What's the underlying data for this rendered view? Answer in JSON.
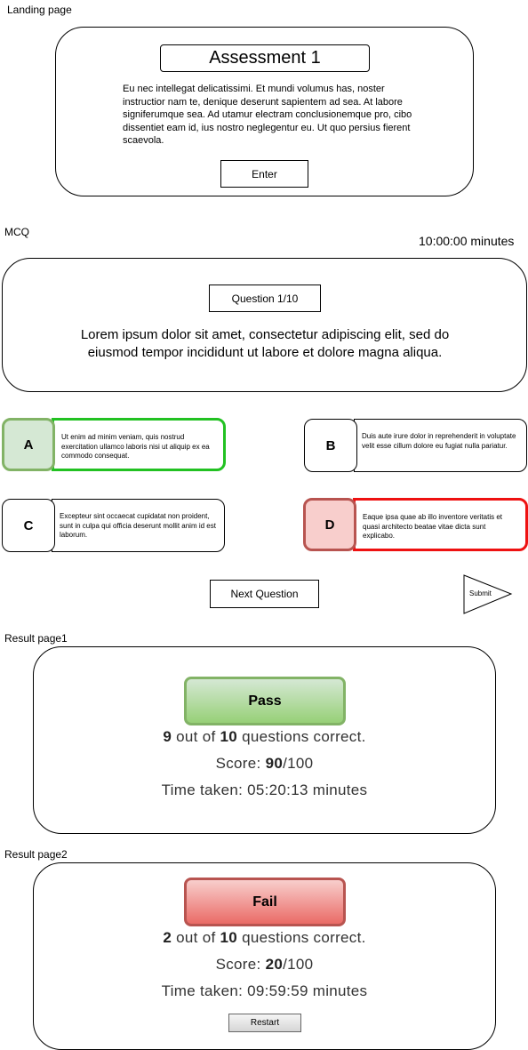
{
  "landing": {
    "section_label": "Landing page",
    "title": "Assessment 1",
    "description": "Eu nec intellegat delicatissimi. Et mundi volumus has, noster instructior nam te, denique deserunt sapientem ad sea. At labore signiferumque sea. Ad utamur electram conclusionemque pro, cibo dissentiet eam id, ius nostro neglegentur eu. Ut quo persius fierent scaevola.",
    "enter_label": "Enter"
  },
  "mcq": {
    "section_label": "MCQ",
    "timer": "10:00:00 minutes",
    "question_number": "Question 1/10",
    "question_text": "Lorem ipsum dolor sit amet, consectetur adipiscing elit, sed do eiusmod tempor incididunt ut labore et dolore magna aliqua.",
    "options": [
      {
        "letter": "A",
        "text": "Ut enim ad minim veniam, quis nostrud exercitation ullamco laboris nisi ut aliquip ex ea commodo consequat.",
        "state": "correct"
      },
      {
        "letter": "B",
        "text": "Duis aute irure dolor in reprehenderit in voluptate velit esse cillum dolore eu fugiat nulla pariatur.",
        "state": "default"
      },
      {
        "letter": "C",
        "text": "Excepteur sint occaecat cupidatat non proident, sunt in culpa qui officia deserunt mollit anim id est laborum.",
        "state": "default"
      },
      {
        "letter": "D",
        "text": "Eaque ipsa quae ab illo inventore veritatis et quasi architecto beatae vitae dicta sunt explicabo.",
        "state": "wrong"
      }
    ],
    "next_label": "Next Question",
    "submit_label": "Submit"
  },
  "result1": {
    "section_label": "Result page1",
    "badge": "Pass",
    "correct": "9",
    "total": "10",
    "correct_suffix": "questions correct.",
    "out_of": "out of",
    "score_label": "Score:",
    "score": "90",
    "score_max": "/100",
    "time_label": "Time taken:",
    "time": "05:20:13 minutes"
  },
  "result2": {
    "section_label": "Result page2",
    "badge": "Fail",
    "correct": "2",
    "total": "10",
    "correct_suffix": "questions correct.",
    "out_of": "out of",
    "score_label": "Score:",
    "score": "20",
    "score_max": "/100",
    "time_label": "Time taken:",
    "time": "09:59:59 minutes",
    "restart_label": "Restart"
  },
  "colors": {
    "correct_border": "#22c122",
    "correct_fill": "#d5e8d4",
    "wrong_border": "#ee1111",
    "wrong_fill": "#f8cecc",
    "pass_fill": "#97d077",
    "fail_fill": "#ea6b66"
  }
}
